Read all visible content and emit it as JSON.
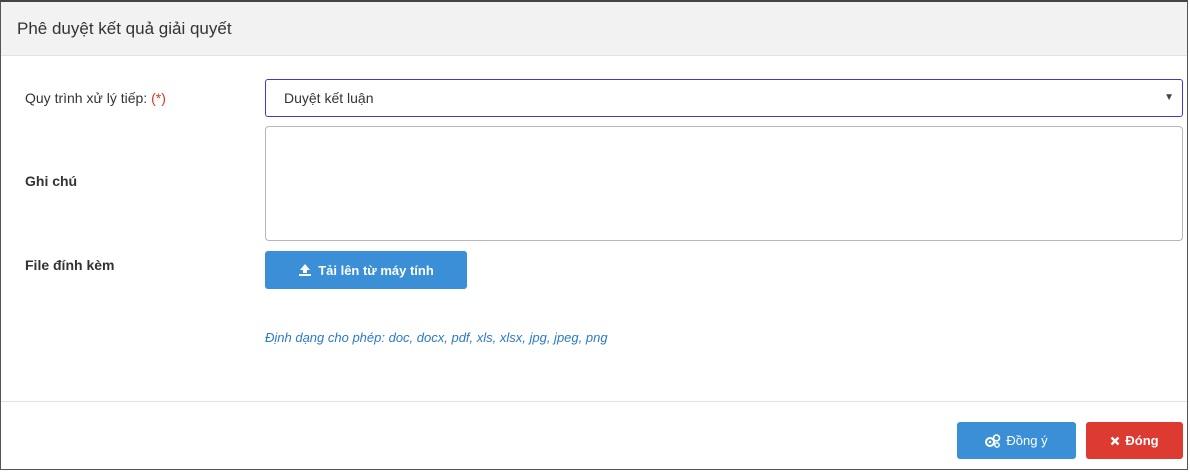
{
  "dialog": {
    "title": "Phê duyệt kết quả giải quyết"
  },
  "form": {
    "process": {
      "label": "Quy trình xử lý tiếp:",
      "required_mark": "(*)",
      "selected_value": "Duyệt kết luận",
      "arrow_icon": "caret-down-icon"
    },
    "note": {
      "label": "Ghi chú",
      "value": ""
    },
    "attachment": {
      "label": "File đính kèm",
      "upload_label": "Tải lên từ máy tính",
      "upload_icon": "upload-icon",
      "allowed_formats": "Định dạng cho phép: doc, docx, pdf, xls, xlsx, jpg, jpeg, png"
    }
  },
  "footer": {
    "ok_label": "Đồng ý",
    "ok_icon": "cogs-icon",
    "close_label": "Đóng",
    "close_icon": "close-icon"
  },
  "colors": {
    "primary": "#3a8fd6",
    "danger": "#dd3a32",
    "link": "#2a7ac9",
    "required": "#e0322a"
  }
}
